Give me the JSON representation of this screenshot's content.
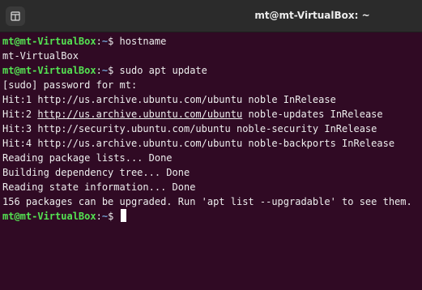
{
  "window": {
    "title": "mt@mt-VirtualBox: ~"
  },
  "titlebar": {
    "new_tab_icon": "new-tab-icon"
  },
  "colors": {
    "background": "#300a24",
    "prompt_user": "#54e352",
    "prompt_path": "#729fcf",
    "text": "#ededed"
  },
  "terminal": {
    "lines": [
      {
        "type": "prompt",
        "user": "mt@mt-VirtualBox",
        "sep": ":",
        "path": "~",
        "symbol": "$ ",
        "cmd": "hostname"
      },
      {
        "type": "output",
        "text": "mt-VirtualBox"
      },
      {
        "type": "prompt",
        "user": "mt@mt-VirtualBox",
        "sep": ":",
        "path": "~",
        "symbol": "$ ",
        "cmd": "sudo apt update"
      },
      {
        "type": "output",
        "text": "[sudo] password for mt:"
      },
      {
        "type": "output",
        "text": "Hit:1 http://us.archive.ubuntu.com/ubuntu noble InRelease"
      },
      {
        "type": "output_link",
        "prefix": "Hit:2 ",
        "link": "http://us.archive.ubuntu.com/ubuntu",
        "suffix": " noble-updates InRelease"
      },
      {
        "type": "output",
        "text": "Hit:3 http://security.ubuntu.com/ubuntu noble-security InRelease"
      },
      {
        "type": "output",
        "text": "Hit:4 http://us.archive.ubuntu.com/ubuntu noble-backports InRelease"
      },
      {
        "type": "output",
        "text": "Reading package lists... Done"
      },
      {
        "type": "output",
        "text": "Building dependency tree... Done"
      },
      {
        "type": "output",
        "text": "Reading state information... Done"
      },
      {
        "type": "output",
        "text": "156 packages can be upgraded. Run 'apt list --upgradable' to see them."
      },
      {
        "type": "prompt_current",
        "user": "mt@mt-VirtualBox",
        "sep": ":",
        "path": "~",
        "symbol": "$ "
      }
    ]
  }
}
